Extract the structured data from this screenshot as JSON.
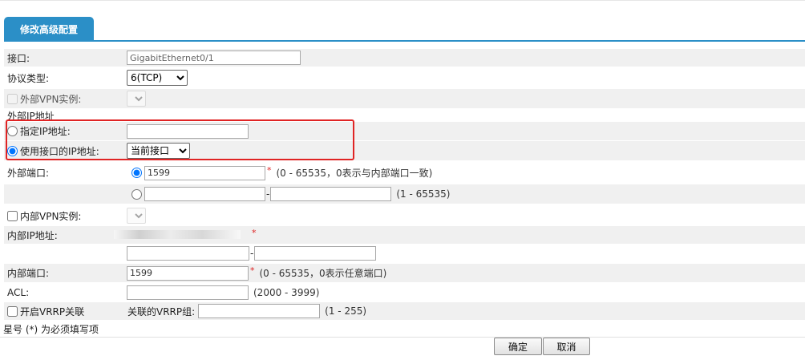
{
  "tab": {
    "title": "修改高级配置"
  },
  "fields": {
    "interface": {
      "label": "接口:",
      "value": "GigabitEthernet0/1"
    },
    "protocol": {
      "label": "协议类型:",
      "selected": "6(TCP)"
    },
    "ext_vpn": {
      "label": "外部VPN实例:"
    },
    "ext_ip_section": {
      "label": "外部IP地址"
    },
    "specified_ip": {
      "label": "指定IP地址:",
      "value": ""
    },
    "use_iface_ip": {
      "label": "使用接口的IP地址:",
      "selected": "当前接口"
    },
    "ext_port": {
      "label": "外部端口:",
      "value": "1599",
      "hint": "(0 - 65535，0表示与内部端口一致)",
      "range_start": "",
      "range_end": "",
      "range_hint": "(1 - 65535)"
    },
    "int_vpn": {
      "label": "内部VPN实例:"
    },
    "int_ip": {
      "label": "内部IP地址:",
      "range_start": "",
      "range_end": ""
    },
    "int_port": {
      "label": "内部端口:",
      "value": "1599",
      "hint": "(0 - 65535，0表示任意端口)"
    },
    "acl": {
      "label": "ACL:",
      "value": "",
      "hint": "(2000 - 3999)"
    },
    "vrrp": {
      "label": "开启VRRP关联",
      "group_label": "关联的VRRP组:",
      "group_value": "",
      "hint": "(1 - 255)"
    }
  },
  "required": {
    "marker": "*"
  },
  "footer": {
    "note": "星号 (*) 为必须填写项"
  },
  "buttons": {
    "ok": "确定",
    "cancel": "取消"
  },
  "colors": {
    "accent": "#2b8fc7",
    "highlight": "#e02424",
    "row_alt": "#f0f0f0"
  }
}
